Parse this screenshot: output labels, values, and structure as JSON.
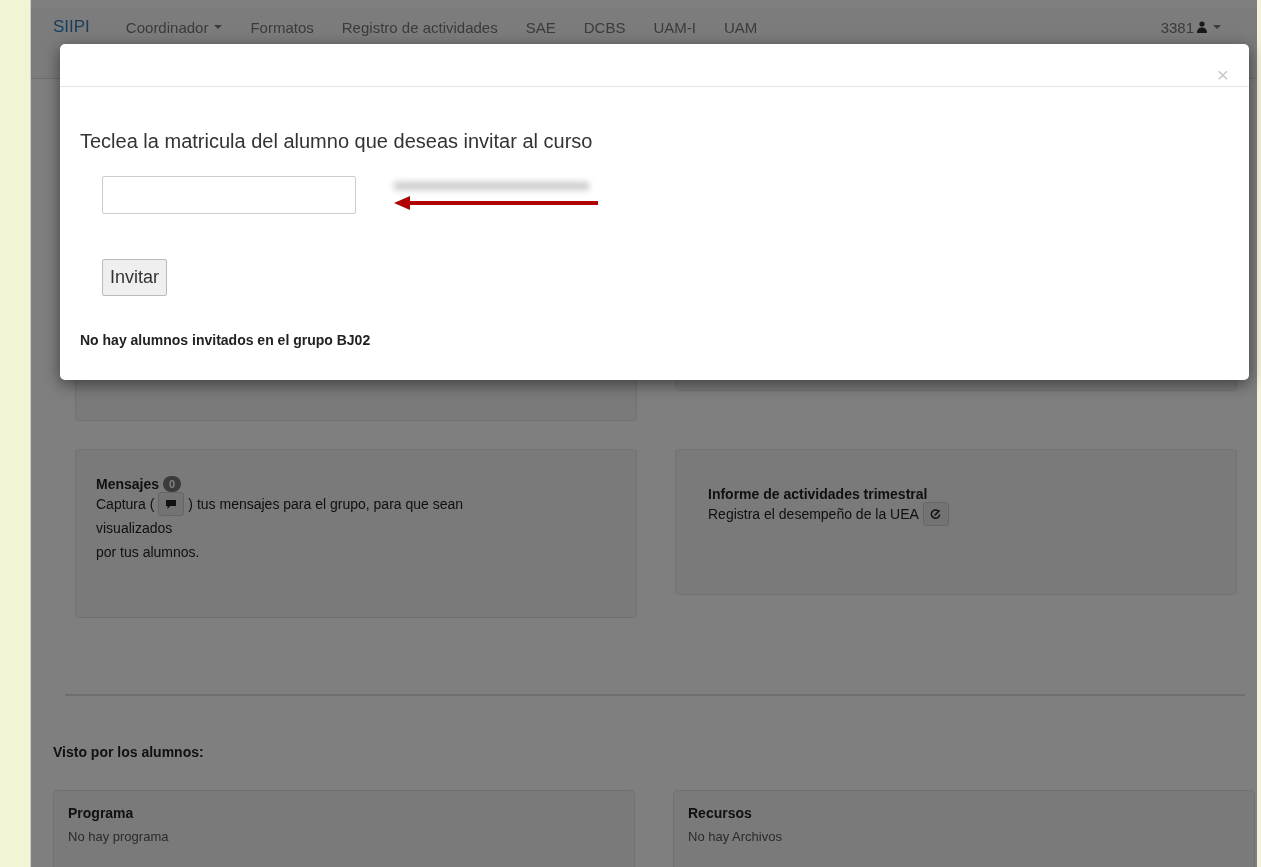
{
  "navbar": {
    "brand": "SIIPI",
    "items": [
      {
        "label": "Coordinador",
        "dropdown": true
      },
      {
        "label": "Formatos",
        "dropdown": false
      },
      {
        "label": "Registro de actividades",
        "dropdown": false
      },
      {
        "label": "SAE",
        "dropdown": false
      },
      {
        "label": "DCBS",
        "dropdown": false
      },
      {
        "label": "UAM-I",
        "dropdown": false
      },
      {
        "label": "UAM",
        "dropdown": false
      }
    ],
    "user": "3381"
  },
  "panels": [
    {
      "kind": "messages",
      "title": "Mensajes",
      "badge": "0",
      "before": "Captura (",
      "after": ") tus mensajes para el grupo, para que sean",
      "lines": [
        "visualizados",
        "por tus alumnos."
      ]
    },
    {
      "kind": "report",
      "title": "Informe de actividades trimestral",
      "text": "Registra el desempeño de la UEA"
    }
  ],
  "section_title": "Visto por los alumnos:",
  "student_panels": [
    {
      "title": "Programa",
      "text": "No hay programa"
    },
    {
      "title": "Recursos",
      "text": "No hay Archivos"
    }
  ],
  "modal": {
    "close": "×",
    "title": "Teclea la matricula del alumno que deseas invitar al curso",
    "button": "Invitar",
    "message": "No hay alumnos invitados en el grupo BJ02"
  }
}
